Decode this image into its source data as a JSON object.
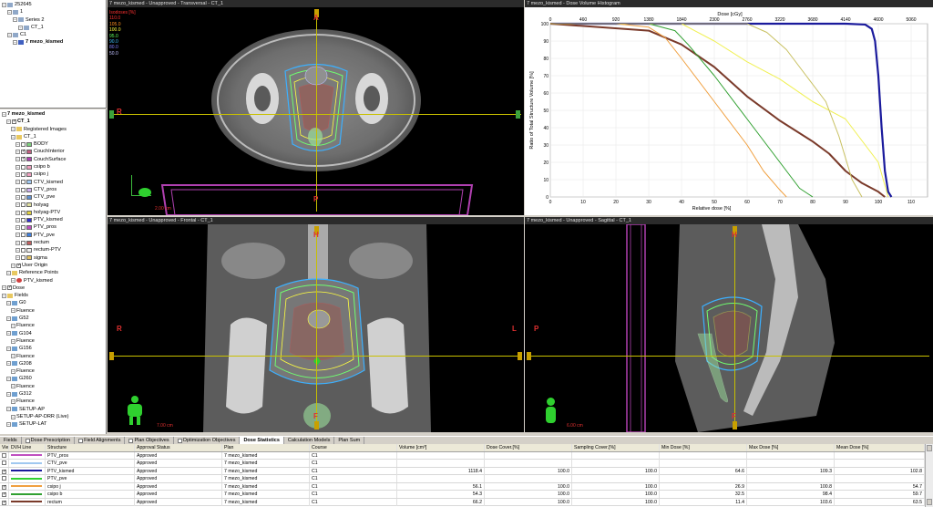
{
  "patient_tree": [
    {
      "label": "252645",
      "level": 0,
      "icon": "patient-icon"
    },
    {
      "label": "1",
      "level": 1,
      "icon": "study-icon"
    },
    {
      "label": "Series 2",
      "level": 2,
      "icon": "series-icon"
    },
    {
      "label": "CT_1",
      "level": 3,
      "icon": "image-icon"
    },
    {
      "label": "C1",
      "level": 1,
      "icon": "course-icon"
    },
    {
      "label": "7 mezo_kismed",
      "level": 2,
      "icon": "plan-icon",
      "bold": true
    }
  ],
  "scope_tree": [
    {
      "label": "7 mezo_kismed",
      "level": 0,
      "bold": true
    },
    {
      "label": "CT_1",
      "level": 1,
      "bold": true,
      "check": true
    },
    {
      "label": "Registered Images",
      "level": 2,
      "folder": true
    },
    {
      "label": "CT_1",
      "level": 2,
      "folder": true
    },
    {
      "label": "BODY",
      "level": 3,
      "color": "#7fd17f",
      "check": false
    },
    {
      "label": "CouchInterior",
      "level": 3,
      "color": "#c06080",
      "check": true
    },
    {
      "label": "CouchSurface",
      "level": 3,
      "color": "#b040b0",
      "check": true
    },
    {
      "label": "csipo b",
      "level": 3,
      "color": "#f0a0c0",
      "check": false
    },
    {
      "label": "csipo j",
      "level": 3,
      "color": "#f0a0c0",
      "check": false
    },
    {
      "label": "CTV_kismed",
      "level": 3,
      "color": "#a0c8f0",
      "check": false
    },
    {
      "label": "CTV_pros",
      "level": 3,
      "color": "#d0b0f0",
      "check": false
    },
    {
      "label": "CTV_pve",
      "level": 3,
      "color": "#6090d0",
      "check": false
    },
    {
      "label": "holyag",
      "level": 3,
      "color": "#e0e0a0",
      "check": false
    },
    {
      "label": "holyag-PTV",
      "level": 3,
      "color": "#e0d040",
      "check": false
    },
    {
      "label": "PTV_kismed",
      "level": 3,
      "color": "#3030d0",
      "check": false
    },
    {
      "label": "PTV_pros",
      "level": 3,
      "color": "#c050c0",
      "check": false
    },
    {
      "label": "PTV_pve",
      "level": 3,
      "color": "#4080e0",
      "check": false
    },
    {
      "label": "rectum",
      "level": 3,
      "color": "#c06060",
      "check": false
    },
    {
      "label": "rectum-PTV",
      "level": 3,
      "color": "#f0f0f0",
      "check": false
    },
    {
      "label": "sigma",
      "level": 3,
      "color": "#e0c060",
      "check": false
    },
    {
      "label": "User Origin",
      "level": 2,
      "check": true
    },
    {
      "label": "Reference Points",
      "level": 1,
      "folder": true
    },
    {
      "label": "PTV_kismed",
      "level": 2,
      "point": true
    },
    {
      "label": "Dose",
      "level": 0,
      "check": true
    },
    {
      "label": "Fields",
      "level": 0,
      "folder": true
    },
    {
      "label": "G0",
      "level": 1,
      "field": true
    },
    {
      "label": "Fluence",
      "level": 2
    },
    {
      "label": "G52",
      "level": 1,
      "field": true
    },
    {
      "label": "Fluence",
      "level": 2
    },
    {
      "label": "G104",
      "level": 1,
      "field": true
    },
    {
      "label": "Fluence",
      "level": 2
    },
    {
      "label": "G156",
      "level": 1,
      "field": true
    },
    {
      "label": "Fluence",
      "level": 2
    },
    {
      "label": "G208",
      "level": 1,
      "field": true
    },
    {
      "label": "Fluence",
      "level": 2
    },
    {
      "label": "G260",
      "level": 1,
      "field": true
    },
    {
      "label": "Fluence",
      "level": 2
    },
    {
      "label": "G312",
      "level": 1,
      "field": true
    },
    {
      "label": "Fluence",
      "level": 2
    },
    {
      "label": "SETUP-AP",
      "level": 1,
      "field": true
    },
    {
      "label": "SETUP-AP-DRR (Live)",
      "level": 2
    },
    {
      "label": "SETUP-LAT",
      "level": 1,
      "field": true
    }
  ],
  "views": {
    "transversal": {
      "title": "7 mezo_kismed - Unapproved - Transversal - CT_1",
      "top": "A",
      "left": "R",
      "bottom": "P",
      "scale": "2.00 cm"
    },
    "frontal": {
      "title": "7 mezo_kismed - Unapproved - Frontal - CT_1",
      "top": "H",
      "left": "R",
      "right": "L",
      "bottom": "F",
      "scale": "7.00 cm"
    },
    "sagittal": {
      "title": "7 mezo_kismed - Unapproved - Sagittal - CT_1",
      "top": "H",
      "left": "P",
      "bottom": "F",
      "scale": "6.00 cm"
    },
    "dvh": {
      "title": "7 mezo_kismed - Dose Volume Histogram"
    }
  },
  "isodose_legend": {
    "title": "Isodoses [%]",
    "levels": [
      {
        "label": "110.0",
        "color": "#ff3030"
      },
      {
        "label": "105.0",
        "color": "#ff9020"
      },
      {
        "label": "100.0",
        "color": "#ffff40"
      },
      {
        "label": "95.0",
        "color": "#60ff60"
      },
      {
        "label": "90.0",
        "color": "#40c0ff"
      },
      {
        "label": "80.0",
        "color": "#8080ff"
      },
      {
        "label": "50.0",
        "color": "#c0c0ff"
      }
    ]
  },
  "chart_data": {
    "type": "line",
    "title": "7 mezo_kismed - Dose Volume Histogram",
    "xlabel": "Relative dose [%]",
    "x2label": "Dose [cGy]",
    "ylabel": "Ratio of Total Structure Volume [%]",
    "xlim": [
      0,
      115
    ],
    "ylim": [
      0,
      100
    ],
    "x_ticks": [
      0,
      10,
      20,
      30,
      40,
      50,
      60,
      70,
      80,
      90,
      100,
      110
    ],
    "x2_ticks": [
      0,
      460,
      920,
      1380,
      1840,
      2300,
      2760,
      3220,
      3680,
      4140,
      4600,
      5060
    ],
    "y_ticks": [
      0,
      10,
      20,
      30,
      40,
      50,
      60,
      70,
      80,
      90,
      100
    ],
    "grid": true,
    "series": [
      {
        "name": "PTV_kismed",
        "color": "#1a1a9c",
        "width": 2.2,
        "x": [
          0,
          90,
          96,
          98,
          99,
          100,
          101,
          102,
          103,
          104
        ],
        "y": [
          100,
          100,
          99.5,
          97,
          90,
          70,
          40,
          15,
          3,
          0
        ]
      },
      {
        "name": "rectum",
        "color": "#7a3a2a",
        "width": 2,
        "x": [
          0,
          30,
          40,
          50,
          60,
          70,
          80,
          85,
          90,
          95,
          100,
          102
        ],
        "y": [
          100,
          96,
          88,
          75,
          58,
          44,
          32,
          25,
          15,
          8,
          3,
          0
        ]
      },
      {
        "name": "csipo j",
        "color": "#f0a040",
        "width": 1,
        "x": [
          0,
          20,
          30,
          35,
          40,
          50,
          60,
          65,
          70,
          72
        ],
        "y": [
          100,
          100,
          98,
          92,
          80,
          55,
          30,
          15,
          4,
          0
        ]
      },
      {
        "name": "csipo b",
        "color": "#30a030",
        "width": 1,
        "x": [
          0,
          30,
          38,
          42,
          50,
          60,
          70,
          76,
          80
        ],
        "y": [
          100,
          100,
          96,
          88,
          70,
          45,
          20,
          5,
          0
        ]
      },
      {
        "name": "holyag",
        "color": "#f0f050",
        "width": 1,
        "x": [
          0,
          40,
          50,
          60,
          70,
          80,
          90,
          100,
          103
        ],
        "y": [
          100,
          100,
          90,
          78,
          68,
          55,
          45,
          20,
          0
        ]
      },
      {
        "name": "sigma",
        "color": "#c8c060",
        "width": 1,
        "x": [
          0,
          60,
          66,
          72,
          78,
          84,
          88,
          92,
          95
        ],
        "y": [
          100,
          100,
          95,
          85,
          70,
          55,
          35,
          10,
          0
        ]
      }
    ]
  },
  "tabs": [
    "Fields",
    "Dose Prescription",
    "Field Alignments",
    "Plan Objectives",
    "Optimization Objectives",
    "Dose Statistics",
    "Calculation Models",
    "Plan Sum"
  ],
  "selected_tab": "Dose Statistics",
  "table": {
    "headers": [
      "View",
      "DVH Line",
      "Structure",
      "Approval Status",
      "Plan",
      "Course",
      "Volume [cm³]",
      "Dose Cover.[%]",
      "Sampling Cover.[%]",
      "Min Dose [%]",
      "Max Dose [%]",
      "Mean Dose [%]"
    ],
    "rows": [
      {
        "check": false,
        "line": "#c050c0",
        "structure": "PTV_pros",
        "status": "Approved",
        "plan": "7 mezo_kismed",
        "course": "C1",
        "volume": "",
        "dose_cover": "",
        "sampling": "",
        "min": "",
        "max": "",
        "mean": ""
      },
      {
        "check": false,
        "line": "#a0c8f0",
        "structure": "CTV_pve",
        "status": "Approved",
        "plan": "7 mezo_kismed",
        "course": "C1",
        "volume": "",
        "dose_cover": "",
        "sampling": "",
        "min": "",
        "max": "",
        "mean": ""
      },
      {
        "check": true,
        "line": "#1a1a9c",
        "structure": "PTV_kismed",
        "status": "Approved",
        "plan": "7 mezo_kismed",
        "course": "C1",
        "volume": "1118.4",
        "dose_cover": "100.0",
        "sampling": "100.0",
        "min": "64.6",
        "max": "109.3",
        "mean": "102.8"
      },
      {
        "check": false,
        "line": "#30d030",
        "structure": "PTV_pve",
        "status": "Approved",
        "plan": "7 mezo_kismed",
        "course": "C1",
        "volume": "",
        "dose_cover": "",
        "sampling": "",
        "min": "",
        "max": "",
        "mean": ""
      },
      {
        "check": true,
        "line": "#f0a040",
        "structure": "csipo j",
        "status": "Approved",
        "plan": "7 mezo_kismed",
        "course": "C1",
        "volume": "56.1",
        "dose_cover": "100.0",
        "sampling": "100.0",
        "min": "26.9",
        "max": "100.8",
        "mean": "54.7"
      },
      {
        "check": true,
        "line": "#30a030",
        "structure": "csipo b",
        "status": "Approved",
        "plan": "7 mezo_kismed",
        "course": "C1",
        "volume": "54.3",
        "dose_cover": "100.0",
        "sampling": "100.0",
        "min": "32.5",
        "max": "98.4",
        "mean": "59.7"
      },
      {
        "check": true,
        "line": "#7a3a2a",
        "structure": "rectum",
        "status": "Approved",
        "plan": "7 mezo_kismed",
        "course": "C1",
        "volume": "66.2",
        "dose_cover": "100.0",
        "sampling": "100.0",
        "min": "11.4",
        "max": "103.6",
        "mean": "63.5"
      }
    ]
  }
}
